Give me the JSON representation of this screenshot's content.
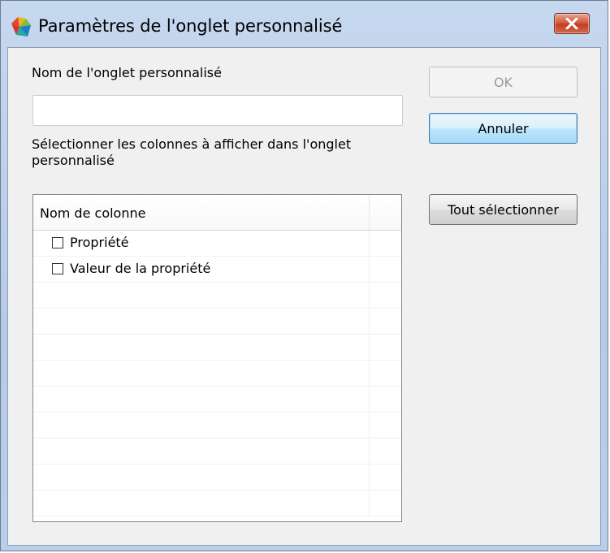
{
  "window": {
    "title": "Paramètres de l'onglet personnalisé",
    "app_icon": "avg-logo-icon",
    "close_icon": "close-icon"
  },
  "form": {
    "name_label": "Nom de l'onglet personnalisé",
    "name_value": "",
    "columns_label_line1": "Sélectionner les colonnes à afficher dans l'onglet",
    "columns_label_line2": "personnalisé"
  },
  "buttons": {
    "ok": "OK",
    "cancel": "Annuler",
    "select_all": "Tout sélectionner"
  },
  "list": {
    "header": "Nom de colonne",
    "rows": [
      {
        "label": "Propriété",
        "checked": false
      },
      {
        "label": "Valeur de la propriété",
        "checked": false
      }
    ],
    "empty_rows": 9
  },
  "colors": {
    "close_button": "#c33c22",
    "frame": "#b9cfe9",
    "client_bg": "#f0f0f0"
  }
}
